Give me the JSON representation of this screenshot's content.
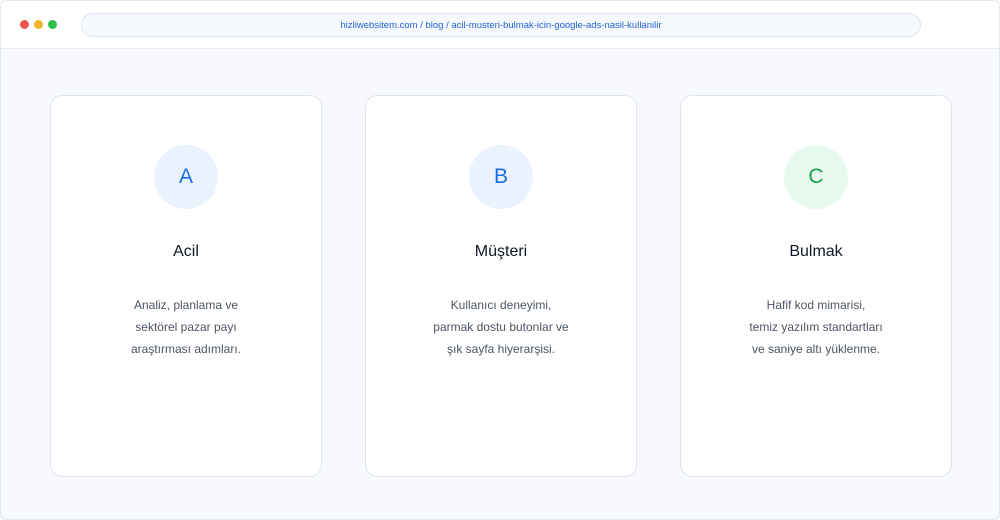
{
  "window": {
    "controls": [
      {
        "name": "close",
        "color": "#ef5450"
      },
      {
        "name": "minimize",
        "color": "#f4b42b"
      },
      {
        "name": "maximize",
        "color": "#2fbf4a"
      }
    ],
    "address": "hizliwebsitem.com / blog / acil-musteri-bulmak-icin-google-ads-nasil-kullanilir"
  },
  "cards": [
    {
      "badge": "A",
      "badge_color": "#1b6fe0",
      "badge_bg": "#eaf2fd",
      "title": "Acil",
      "lines": [
        "Analiz, planlama ve",
        "sektörel pazar payı",
        "araştırması adımları."
      ]
    },
    {
      "badge": "B",
      "badge_color": "#1b6fe0",
      "badge_bg": "#eaf2fd",
      "title": "Müşteri",
      "lines": [
        "Kullanıcı deneyimi,",
        "parmak dostu butonlar ve",
        "şık sayfa hiyerarşisi."
      ]
    },
    {
      "badge": "C",
      "badge_color": "#16a34a",
      "badge_bg": "#e7f8ee",
      "title": "Bulmak",
      "lines": [
        "Hafif kod mimarisi,",
        "temiz yazılım standartları",
        "ve saniye altı yüklenme."
      ]
    }
  ]
}
